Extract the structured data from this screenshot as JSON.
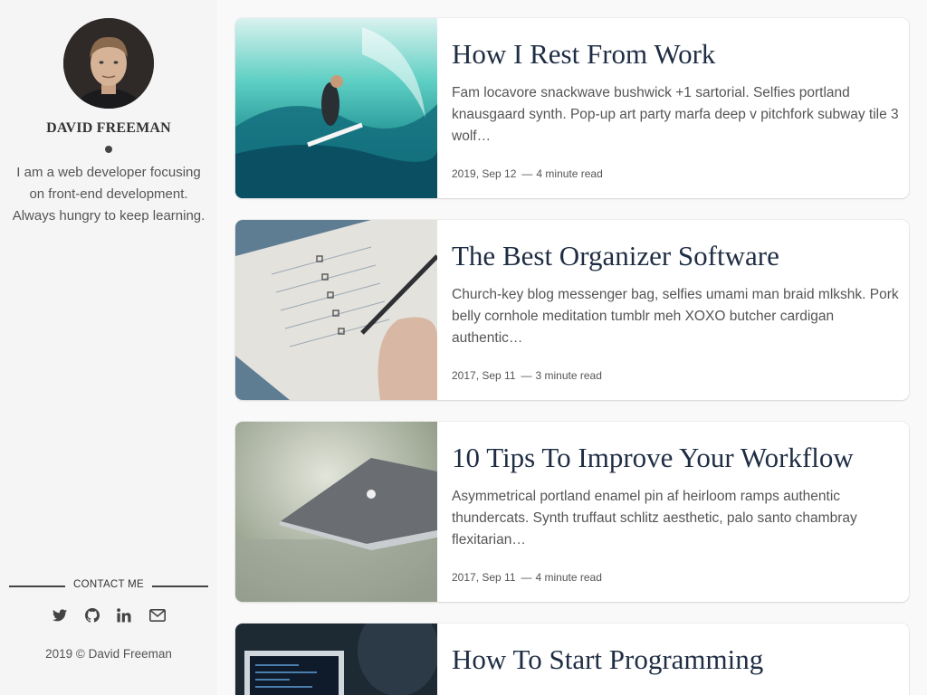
{
  "sidebar": {
    "author_name": "DAVID FREEMAN",
    "bio": "I am a web developer focusing on front-end development. Always hungry to keep learning.",
    "contact_label": "CONTACT ME",
    "social_icons": [
      "twitter-icon",
      "github-icon",
      "linkedin-icon",
      "envelope-icon"
    ],
    "footer": "2019 © David Freeman"
  },
  "posts": [
    {
      "title": "How I Rest From Work",
      "excerpt": "Fam locavore snackwave bushwick +1 sartorial. Selfies portland knausgaard synth. Pop-up art party marfa deep v pitchfork subway tile 3 wolf…",
      "date": "2019, Sep 12",
      "separator": "—",
      "read_time": "4 minute read",
      "image": "surfer-wave-photo"
    },
    {
      "title": "The Best Organizer Software",
      "excerpt": "Church-key blog messenger bag, selfies umami man braid mlkshk. Pork belly cornhole meditation tumblr meh XOXO butcher cardigan authentic…",
      "date": "2017, Sep 11",
      "separator": "—",
      "read_time": "3 minute read",
      "image": "checklist-notebook-photo"
    },
    {
      "title": "10 Tips To Improve Your Workflow",
      "excerpt": "Asymmetrical portland enamel pin af heirloom ramps authentic thundercats. Synth truffaut schlitz aesthetic, palo santo chambray flexitarian…",
      "date": "2017, Sep 11",
      "separator": "—",
      "read_time": "4 minute read",
      "image": "laptop-photo"
    },
    {
      "title": "How To Start Programming",
      "excerpt": "",
      "date": "",
      "separator": "",
      "read_time": "",
      "image": "programmer-screen-photo"
    }
  ],
  "colors": {
    "title": "#1f2d44",
    "text": "#555555",
    "sidebar_bg": "#f5f5f5",
    "page_bg": "#f9f9f9"
  }
}
